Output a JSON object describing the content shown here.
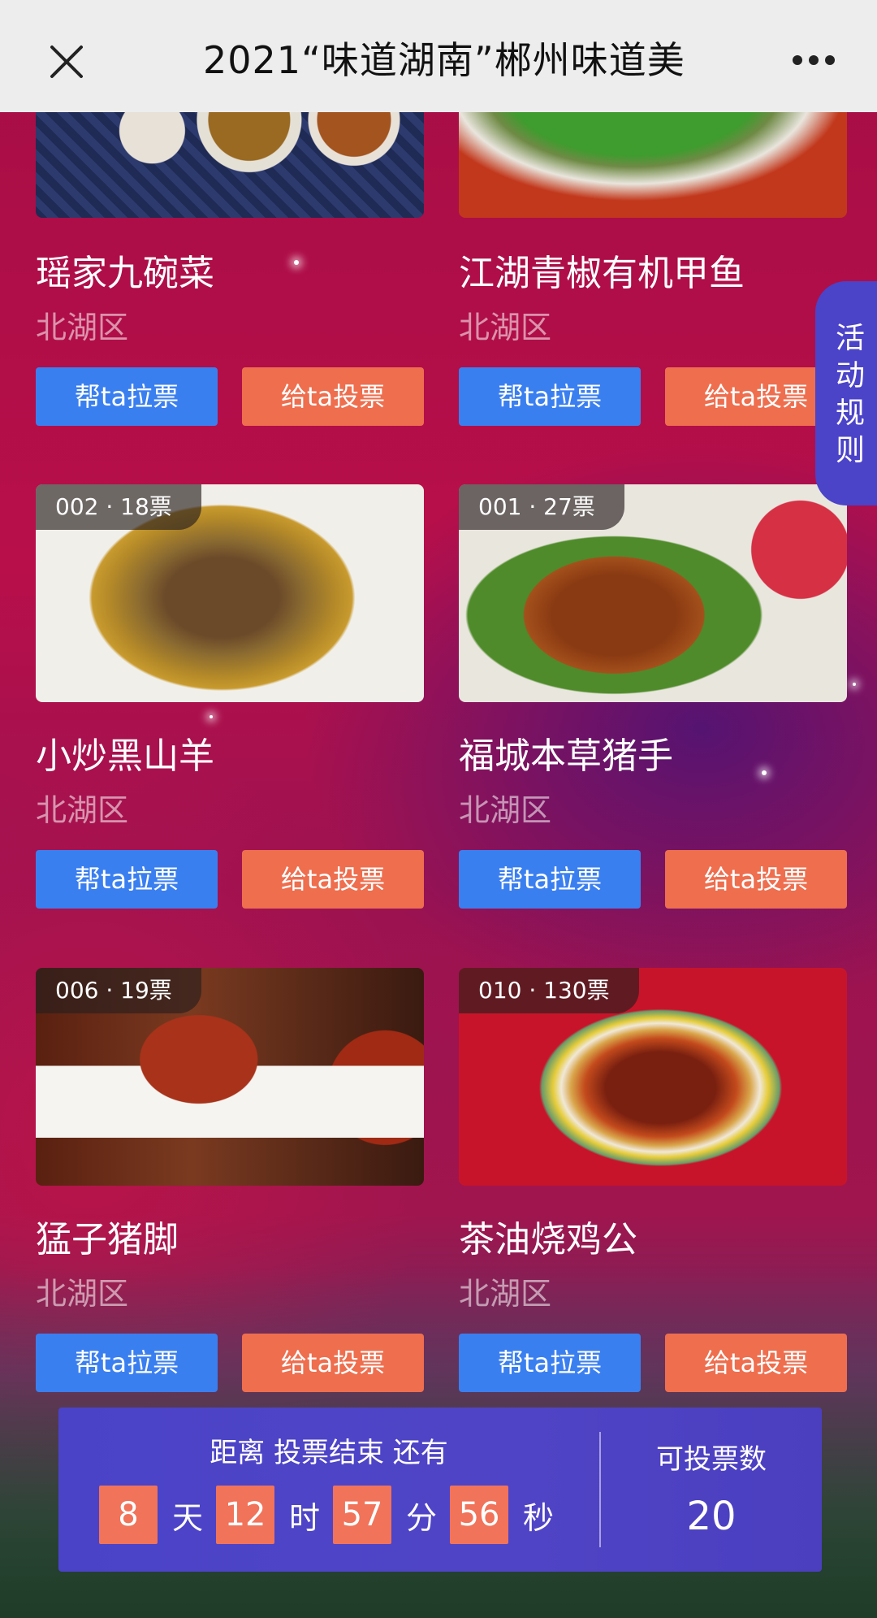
{
  "header": {
    "title": "2021“味道湖南”郴州味道美",
    "close_icon": "close-icon",
    "more_icon": "more-icon"
  },
  "side_tab": {
    "label_chars": [
      "活",
      "动",
      "规",
      "则"
    ]
  },
  "buttons": {
    "canvass": "帮ta拉票",
    "vote": "给ta投票"
  },
  "dishes": [
    {
      "badge": "",
      "name": "瑶家九碗菜",
      "area": "北湖区"
    },
    {
      "badge": "",
      "name": "江湖青椒有机甲鱼",
      "area": "北湖区"
    },
    {
      "badge": "002 · 18票",
      "name": "小炒黑山羊",
      "area": "北湖区"
    },
    {
      "badge": "001 · 27票",
      "name": "福城本草猪手",
      "area": "北湖区"
    },
    {
      "badge": "006 · 19票",
      "name": "猛子猪脚",
      "area": "北湖区"
    },
    {
      "badge": "010 · 130票",
      "name": "茶油烧鸡公",
      "area": "北湖区"
    }
  ],
  "countdown": {
    "label": "距离 投票结束 还有",
    "days": "8",
    "days_unit": "天",
    "hours": "12",
    "hours_unit": "时",
    "minutes": "57",
    "minutes_unit": "分",
    "seconds": "56",
    "seconds_unit": "秒"
  },
  "votes": {
    "label": "可投票数",
    "value": "20"
  },
  "colors": {
    "blue_button": "#3a7ff0",
    "orange_button": "#ee6e4e",
    "panel": "#4b43c8",
    "countdown_box": "#f0735a"
  }
}
